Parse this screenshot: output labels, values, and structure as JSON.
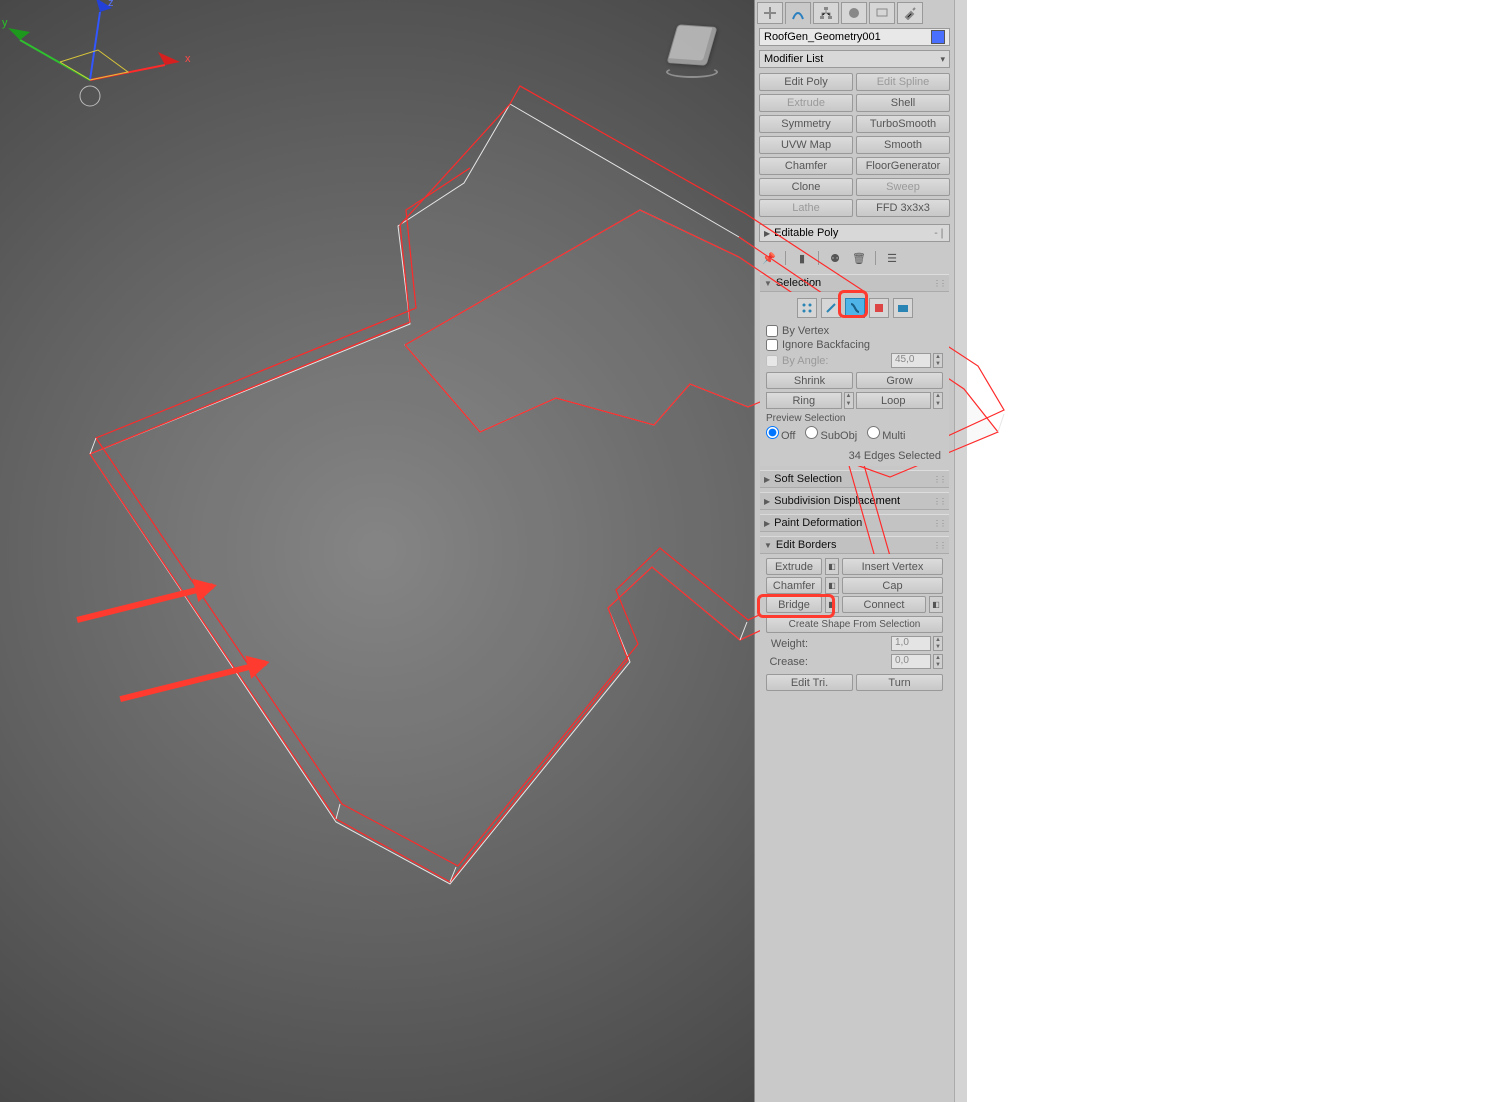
{
  "object_name": "RoofGen_Geometry001",
  "modifier_list_label": "Modifier List",
  "modifier_buttons": [
    {
      "label": "Edit Poly",
      "disabled": false
    },
    {
      "label": "Edit Spline",
      "disabled": true
    },
    {
      "label": "Extrude",
      "disabled": true
    },
    {
      "label": "Shell",
      "disabled": false
    },
    {
      "label": "Symmetry",
      "disabled": false
    },
    {
      "label": "TurboSmooth",
      "disabled": false
    },
    {
      "label": "UVW Map",
      "disabled": false
    },
    {
      "label": "Smooth",
      "disabled": false
    },
    {
      "label": "Chamfer",
      "disabled": false
    },
    {
      "label": "FloorGenerator",
      "disabled": false
    },
    {
      "label": "Clone",
      "disabled": false
    },
    {
      "label": "Sweep",
      "disabled": true
    },
    {
      "label": "Lathe",
      "disabled": true
    },
    {
      "label": "FFD 3x3x3",
      "disabled": false
    }
  ],
  "stack_item": "Editable Poly",
  "selection": {
    "title": "Selection",
    "by_vertex": "By Vertex",
    "ignore_backfacing": "Ignore Backfacing",
    "by_angle": "By Angle:",
    "angle_value": "45,0",
    "shrink": "Shrink",
    "grow": "Grow",
    "ring": "Ring",
    "loop": "Loop",
    "preview_label": "Preview Selection",
    "off": "Off",
    "subobj": "SubObj",
    "multi": "Multi",
    "count": "34 Edges Selected"
  },
  "rollouts": {
    "soft_selection": "Soft Selection",
    "subdiv_disp": "Subdivision Displacement",
    "paint_def": "Paint Deformation",
    "edit_borders": "Edit Borders"
  },
  "edit_borders": {
    "extrude": "Extrude",
    "insert_vertex": "Insert Vertex",
    "chamfer": "Chamfer",
    "cap": "Cap",
    "bridge": "Bridge",
    "connect": "Connect",
    "create_shape": "Create Shape From Selection",
    "weight_lbl": "Weight:",
    "weight_val": "1,0",
    "crease_lbl": "Crease:",
    "crease_val": "0,0",
    "edit_tri": "Edit Tri.",
    "turn": "Turn"
  },
  "axes": {
    "x": "x",
    "y": "y",
    "z": "z"
  }
}
